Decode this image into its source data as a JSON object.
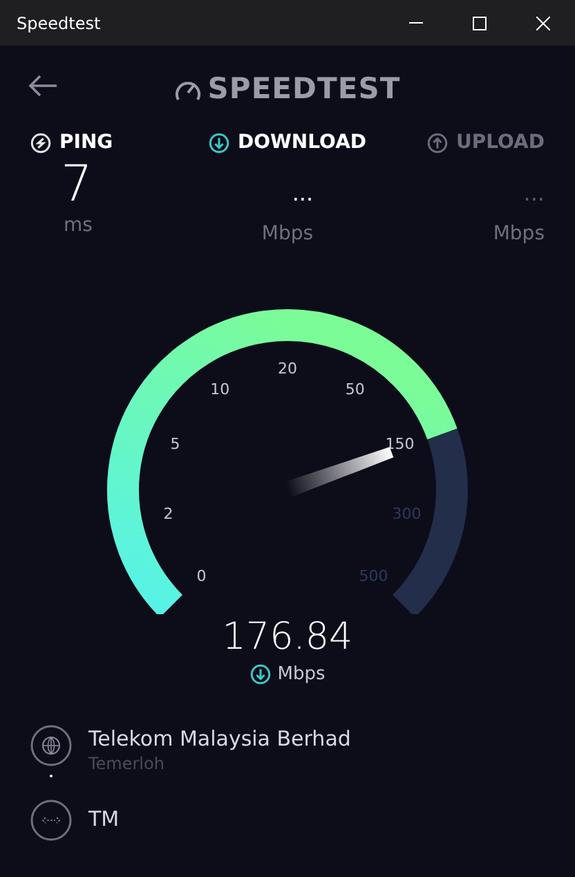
{
  "window": {
    "title": "Speedtest"
  },
  "logo": {
    "text": "SPEEDTEST"
  },
  "metrics": [
    {
      "kind": "ping",
      "label": "PING",
      "value": "7",
      "unit": "ms",
      "dimmed": false
    },
    {
      "kind": "download",
      "label": "DOWNLOAD",
      "value": "...",
      "unit": "Mbps",
      "dimmed": false
    },
    {
      "kind": "upload",
      "label": "UPLOAD",
      "value": "...",
      "unit": "Mbps",
      "dimmed": true
    }
  ],
  "gauge": {
    "ticks": [
      "0",
      "2",
      "5",
      "10",
      "20",
      "50",
      "150",
      "300",
      "500"
    ],
    "reading": "176.84",
    "unit": "Mbps"
  },
  "provider": {
    "name": "Telekom Malaysia Berhad",
    "location": "Temerloh"
  },
  "server": {
    "name": "TM"
  }
}
